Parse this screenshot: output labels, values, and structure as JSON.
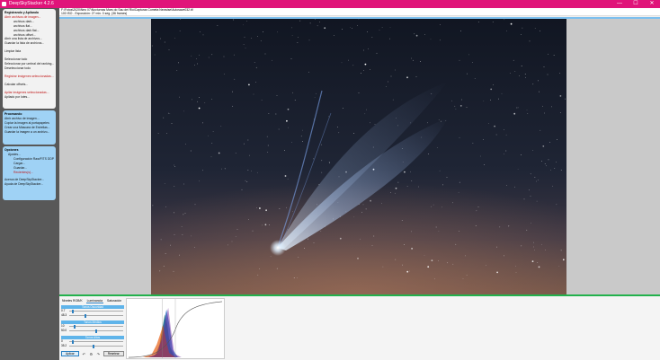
{
  "window": {
    "title": "DeepSkyStacker 4.2.6"
  },
  "titlebar": {
    "minimize": "—",
    "maximize": "☐",
    "close": "✕"
  },
  "sidebar": {
    "register_panel": {
      "title": "Registrando y Apilando",
      "items": [
        {
          "label": "Abrir archivos de imagen...",
          "style": "red"
        },
        {
          "label": "archivos dark...",
          "style": "i2"
        },
        {
          "label": "archivos flat...",
          "style": "i2"
        },
        {
          "label": "archivos dark flat...",
          "style": "i2"
        },
        {
          "label": "archivos offset...",
          "style": "i2"
        },
        {
          "label": "Abrir una lista de archivos...",
          "style": ""
        },
        {
          "label": "Guardar la lista de archivos...",
          "style": ""
        },
        {
          "label": "",
          "style": "gap"
        },
        {
          "label": "Limpiar lista",
          "style": ""
        },
        {
          "label": "",
          "style": "gap"
        },
        {
          "label": "Seleccionar todo",
          "style": ""
        },
        {
          "label": "Seleccionar por umbral del ranking...",
          "style": ""
        },
        {
          "label": "Deseleccionar todo",
          "style": ""
        },
        {
          "label": "",
          "style": "gap"
        },
        {
          "label": "Registrar imágenes seleccionadas...",
          "style": "red"
        },
        {
          "label": "",
          "style": "gap"
        },
        {
          "label": "Calcular offsets...",
          "style": ""
        },
        {
          "label": "",
          "style": "gap"
        },
        {
          "label": "Apilar imágenes seleccionadas...",
          "style": "red"
        },
        {
          "label": "Apilado por lotes...",
          "style": ""
        }
      ]
    },
    "process_panel": {
      "title": "Procesando",
      "items": [
        {
          "label": "Abrir archivo de imagen...",
          "style": ""
        },
        {
          "label": "Copiar la imagen al portapapeles",
          "style": ""
        },
        {
          "label": "Crear una Máscara de Estrellas...",
          "style": ""
        },
        {
          "label": "Guardar la imagen a un archivo...",
          "style": ""
        }
      ]
    },
    "options_panel": {
      "title": "Opciones",
      "items": [
        {
          "label": "Ajustes...",
          "style": "i1"
        },
        {
          "label": "Configuración Raw/FITS DDP...",
          "style": "i2"
        },
        {
          "label": "Cargar...",
          "style": "i2"
        },
        {
          "label": "Guardar...",
          "style": "i2"
        },
        {
          "label": "Recientes(s)...",
          "style": "i2red"
        },
        {
          "label": "",
          "style": "gap"
        },
        {
          "label": "Acerca de DeepSkyStacker...",
          "style": ""
        },
        {
          "label": "Ayuda de DeepSkyStacker...",
          "style": ""
        }
      ]
    }
  },
  "infobar": {
    "path": "F:\\Fotos\\2020\\Neo 07\\Nocturnas Mars do Sau del Rio\\Capturas Cometa Neowise\\Autosave032.tif",
    "details": "100 ISO - Exposición: 27 min. 0 seg. (36 frames)"
  },
  "adjust": {
    "tabs": [
      "Niveles RGB/K",
      "Luminancia",
      "Saturación"
    ],
    "active_tab": 1,
    "groups": [
      {
        "title": "Tonos Oscuridad",
        "v1": "0.7",
        "v2": "48.3",
        "k1": 0.06,
        "k2": 0.3
      },
      {
        "title": "Tonos Medios",
        "v1": "10",
        "v2": "50.0",
        "k1": 0.08,
        "k2": 0.5
      },
      {
        "title": "Tonos Altos",
        "v1": "0",
        "v2": "35.2",
        "k1": 0.05,
        "k2": 0.45
      }
    ],
    "apply": "Aplicar",
    "reset": "Resetear"
  },
  "colors": {
    "accent": "#e0147a",
    "panel_blue": "#9fd2f5",
    "green": "#22b14c"
  }
}
